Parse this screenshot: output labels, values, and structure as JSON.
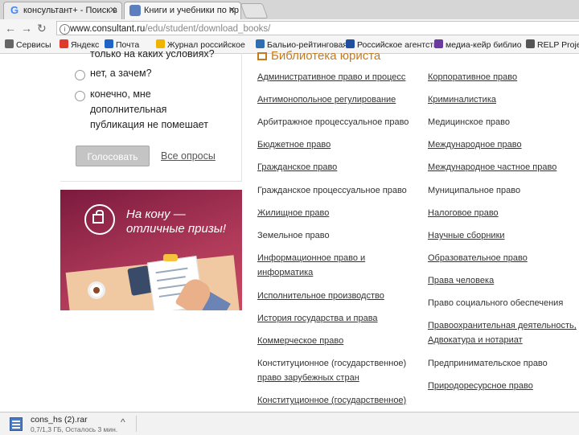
{
  "browser": {
    "tabs": [
      {
        "title": "консультант+ - Поиск в"
      },
      {
        "title": "Книги и учебники по пр"
      }
    ],
    "url": "www.consultant.ru/edu/student/download_books/",
    "url_host": "www.consultant.ru",
    "url_path": "/edu/student/download_books/",
    "bookmarks": [
      {
        "label": "Сервисы"
      },
      {
        "label": "Яндекс"
      },
      {
        "label": "Почта"
      },
      {
        "label": "Журнал российское"
      },
      {
        "label": "Бальио-рейтинговая"
      },
      {
        "label": "Российское агентств"
      },
      {
        "label": "медиа-кейр библио"
      },
      {
        "label": "RELP Project"
      }
    ]
  },
  "poll": {
    "question_tail": "только на каких условиях?",
    "option_no": "нет, а зачем?",
    "option_yes_lines": [
      "конечно, мне",
      "дополнительная",
      "публикация не помешает"
    ],
    "vote_button": "Голосовать",
    "all_polls": "Все опросы"
  },
  "banner": {
    "line1": "На кону —",
    "line2": "отличные призы!"
  },
  "library": {
    "title": "Библиотека юриста",
    "left": [
      "Административное право и процесс",
      "Антимонопольное регулирование",
      "Арбитражное процессуальное право",
      "Бюджетное право",
      "Гражданское право",
      "Гражданское процессуальное право",
      "Жилищное право",
      "Земельное право",
      "Информационное право и",
      "информатика",
      "Исполнительное производство",
      "История государства и права",
      "Коммерческое право",
      "Конституционное (государственное)",
      "право зарубежных стран",
      "Конституционное (государственное)"
    ],
    "right": [
      "Корпоративное право",
      "Криминалистика",
      "Медицинское право",
      "Международное право",
      "Международное частное право",
      "Муниципальное право",
      "Налоговое право",
      "Научные сборники",
      "Образовательное право",
      "Права человека",
      "Право социального обеспечения",
      "Правоохранительная деятельность,",
      "Адвокатура и нотариат",
      "Предпринимательское право",
      "Природоресурсное право"
    ]
  },
  "download": {
    "filename": "cons_hs (2).rar",
    "status": "0,7/1,3 ГБ, Осталось 3 мин."
  }
}
